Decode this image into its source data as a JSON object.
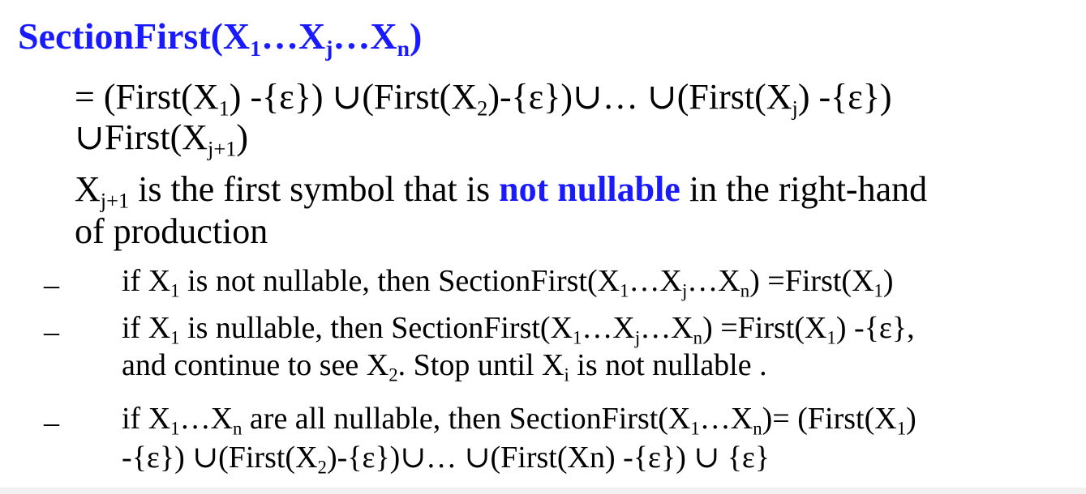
{
  "title": {
    "fn": "SectionFirst(X",
    "s1": "1",
    "dots1": "…X",
    "sj": "j",
    "dots2": "…X",
    "sn": "n",
    "close": ")"
  },
  "definition": {
    "l1": {
      "a": "=  (First(X",
      "s1": "1",
      "b": ")  -{ε})  ∪(First(X",
      "s2": "2",
      "c": ")-{ε})∪…  ∪(First(X",
      "sj": "j",
      "d": ")  -{ε})"
    },
    "l2": {
      "a": "∪First(X",
      "s": "j+1",
      "b": ")"
    }
  },
  "note": {
    "l1": {
      "a": "X",
      "s": "j+1",
      "b": " is the first symbol that is ",
      "hl": "not nullable",
      "c": " in the right-hand"
    },
    "l2": "of production"
  },
  "bullets": {
    "marker": "–",
    "b1": {
      "a": "if X",
      "s1": "1",
      "b": " is not nullable, then SectionFirst(X",
      "s2": "1",
      "c": "…X",
      "sj": "j",
      "d": "…X",
      "sn": "n",
      "e": ") =First(X",
      "s3": "1",
      "f": ")"
    },
    "b2": {
      "l1": {
        "a": "if X",
        "s1": "1",
        "b": " is nullable, then SectionFirst(X",
        "s2": "1",
        "c": "…X",
        "sj": "j",
        "d": "…X",
        "sn": "n",
        "e": ") =First(X",
        "s3": "1",
        "f": ") -{ε},"
      },
      "l2": {
        "a": "and continue to see X",
        "s2": "2",
        "b": ". Stop until X",
        "si": "i",
        "c": " is not nullable ."
      }
    },
    "b3": {
      "l1": {
        "a": "if X",
        "s1": "1",
        "b": "…X",
        "sn": "n",
        "c": " are all nullable, then SectionFirst(X",
        "s2": "1",
        "d": "…X",
        "sn2": "n",
        "e": ")= (First(X",
        "s3": "1",
        "f": ")"
      },
      "l2": {
        "a": "-{ε}) ∪(First(X",
        "s2": "2",
        "b": ")-{ε})∪… ∪(First(Xn) -{ε}) ∪ {ε}"
      }
    }
  }
}
